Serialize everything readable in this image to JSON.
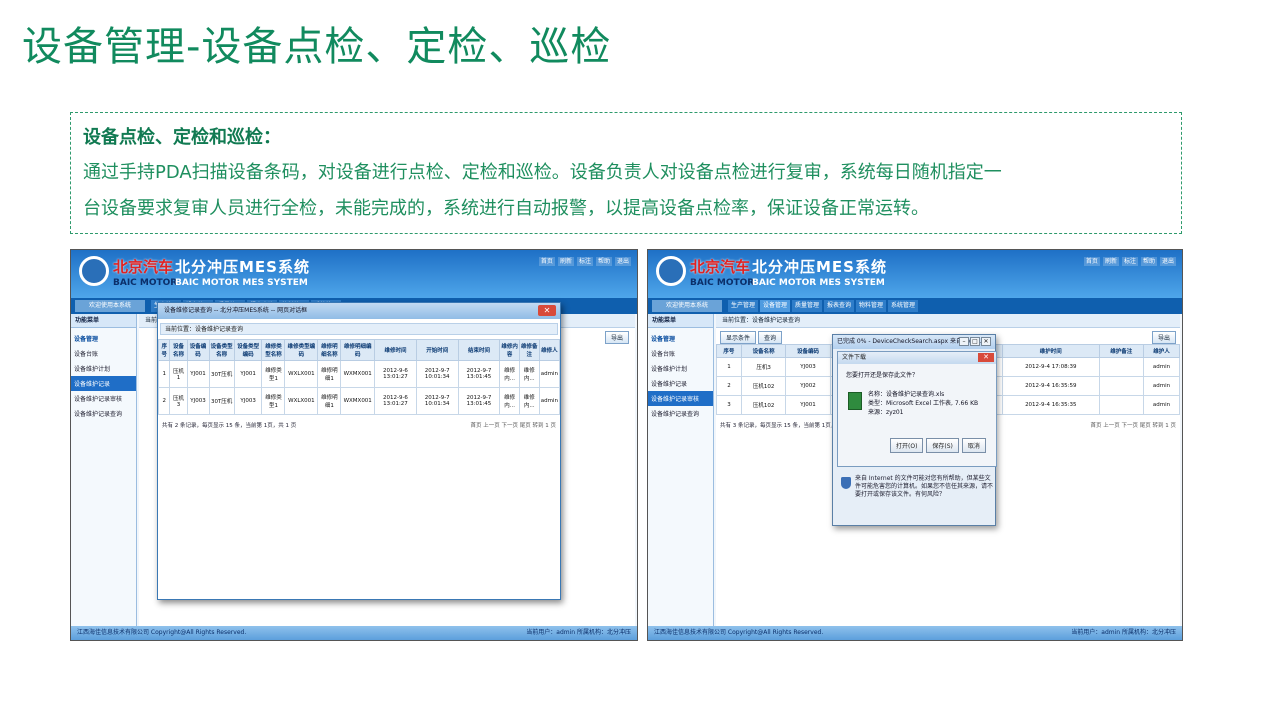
{
  "slide": {
    "title": "设备管理-设备点检、定检、巡检",
    "desc_head": "设备点检、定检和巡检：",
    "desc_line1": "通过手持PDA扫描设备条码，对设备进行点检、定检和巡检。设备负责人对设备点检进行复审，系统每日随机指定一",
    "desc_line2": "台设备要求复审人员进行全检，未能完成的，系统进行自动报警，以提高设备点检率，保证设备正常运转。",
    "title_color": "#118a5e"
  },
  "app": {
    "logo_cn": "北京汽车",
    "logo_en": "BAIC MOTOR",
    "sys_cn": "北分冲压MES系统",
    "sys_en": "BAIC MOTOR MES SYSTEM",
    "top_links": [
      "首页",
      "刷新",
      "标注",
      "帮助",
      "退出"
    ],
    "menu_tabs": [
      "生产管理",
      "设备管理",
      "质量管理",
      "报表查询",
      "物料管理",
      "系统管理"
    ],
    "side_head": "功能菜单",
    "side_group": "设备管理",
    "side_items": [
      "设备台账",
      "设备维护计划",
      "设备维护记录",
      "设备维护记录审核",
      "设备维护记录查询"
    ],
    "crumb": "当前位置：设备维护记录查询",
    "status_left": "江西海佳信息技术有限公司 Copyright@All Rights Reserved.",
    "status_right": "当前用户：admin 所属机构：北分冲压",
    "accent": "#1f6ec7"
  },
  "left": {
    "popup_title": "设备维修记录查询 -- 北分冲压MES系统 -- 网页对话框",
    "popup_crumb": "当前位置：设备维护记录查询",
    "export_label": "导出",
    "columns": [
      "序号",
      "设备名称",
      "设备编码",
      "设备类型名称",
      "设备类型编码",
      "维修类型名称",
      "维修类型编码",
      "维修明细名称",
      "维修明细编码",
      "维修时间",
      "开始时间",
      "结束时间",
      "维修内容",
      "维修备注",
      "维修人"
    ],
    "rows": [
      [
        "1",
        "压机1",
        "YJ001",
        "30T压机",
        "YJ001",
        "维修类型1",
        "WXLX001",
        "维修明细1",
        "WXMX001",
        "2012-9-6 13:01:27",
        "2012-9-7 10:01:34",
        "2012-9-7 13:01:45",
        "维修内...",
        "维修内...",
        "admin"
      ],
      [
        "2",
        "压机3",
        "YJ003",
        "30T压机",
        "YJ003",
        "维修类型1",
        "WXLX001",
        "维修明细1",
        "WXMX001",
        "2012-9-6 13:01:27",
        "2012-9-7 10:01:34",
        "2012-9-7 13:01:45",
        "维修内...",
        "维修内...",
        "admin"
      ]
    ],
    "pager": "共有 2 条记录，每页显示 15 条，当前第 1页，共 1 页",
    "pager_right": "首页 上一页 下一页 尾页  转到 1 页"
  },
  "right": {
    "toolbar": [
      "显示条件",
      "查询"
    ],
    "export_label": "导出",
    "columns": [
      "序号",
      "设备名称",
      "设备编码",
      "设备类型名称",
      "维护明细编码",
      "维护内容",
      "维护时间",
      "维护备注",
      "维护人"
    ],
    "rows": [
      [
        "1",
        "压机3",
        "YJ003",
        "30T压机",
        "WXMX002",
        "",
        "2012-9-4 17:08:39",
        "",
        "admin"
      ],
      [
        "2",
        "压机102",
        "YJ002",
        "30T压机",
        "001",
        "",
        "2012-9-4 16:35:59",
        "",
        "admin"
      ],
      [
        "3",
        "压机102",
        "YJ001",
        "30T压机",
        "001",
        "",
        "2012-9-4 16:35:35",
        "",
        "admin"
      ]
    ],
    "pager": "共有 3 条记录，每页显示 15 条，当前第 1页，共",
    "pager_right": "首页 上一页 下一页 尾页  转到 1 页",
    "dialog_title": "已完成 0% - DeviceCheckSearch.aspx 来自 zyz01",
    "inner_title": "文件下载",
    "question": "您要打开还是保存此文件？",
    "file_name": "名称：设备维护记录查询.xls",
    "file_type": "类型：Microsoft Excel 工作表, 7.66 KB",
    "file_from": "来源：zyz01",
    "btn_open": "打开(O)",
    "btn_save": "保存(S)",
    "btn_cancel": "取消",
    "warning": "来自 Internet 的文件可能对您有所帮助，但某些文件可能危害您的计算机。如果您不信任其来源，请不要打开或保存该文件。有何风险？"
  }
}
